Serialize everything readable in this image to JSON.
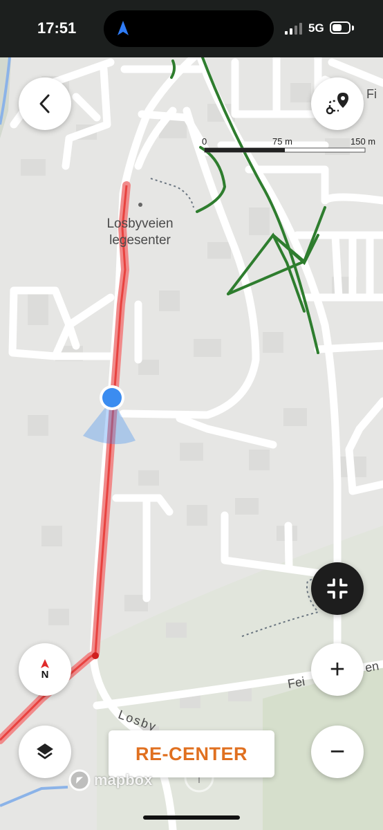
{
  "status_bar": {
    "time": "17:51",
    "network": "5G"
  },
  "map": {
    "labels": {
      "poi_name": "Losbyveien\nlegesenter",
      "street_fi": "Fi",
      "street_fei": "Fei",
      "street_en": "en",
      "street_losby": "Losby"
    },
    "scale": {
      "marks": [
        "0",
        "75 m",
        "150 m"
      ]
    },
    "attribution": "mapbox",
    "colors": {
      "route": "#ee5a5a",
      "trail": "#2e7d2e",
      "user_location": "#3b8cf0",
      "recenter_text": "#e07020"
    }
  },
  "controls": {
    "back_icon": "chevron-left-icon",
    "route_icon": "route-pin-icon",
    "collapse_icon": "collapse-arrows-icon",
    "compass_label": "N",
    "zoom_in_label": "+",
    "zoom_out_label": "−",
    "layers_icon": "layers-icon",
    "recenter_label": "RE-CENTER"
  }
}
